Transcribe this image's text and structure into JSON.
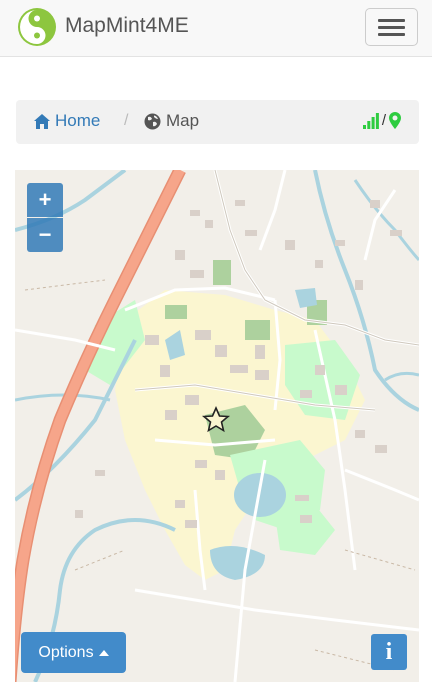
{
  "navbar": {
    "brand": "MapMint4ME",
    "colors": {
      "logo_green": "#8dc63f"
    }
  },
  "breadcrumb": {
    "home_label": "Home",
    "separator": "/",
    "map_label": "Map",
    "status_separator": "/",
    "icons": [
      "home-icon",
      "globe-icon",
      "signal-icon",
      "map-marker-icon"
    ],
    "colors": {
      "link": "#337ab7",
      "status": "#2ecc40"
    }
  },
  "map": {
    "zoom_in_label": "+",
    "zoom_out_label": "−",
    "options_label": "Options",
    "info_label": "i",
    "colors": {
      "button": "#428bca",
      "motorway": "#f6a58a",
      "water": "#aad3df",
      "park": "#c8facc"
    }
  }
}
